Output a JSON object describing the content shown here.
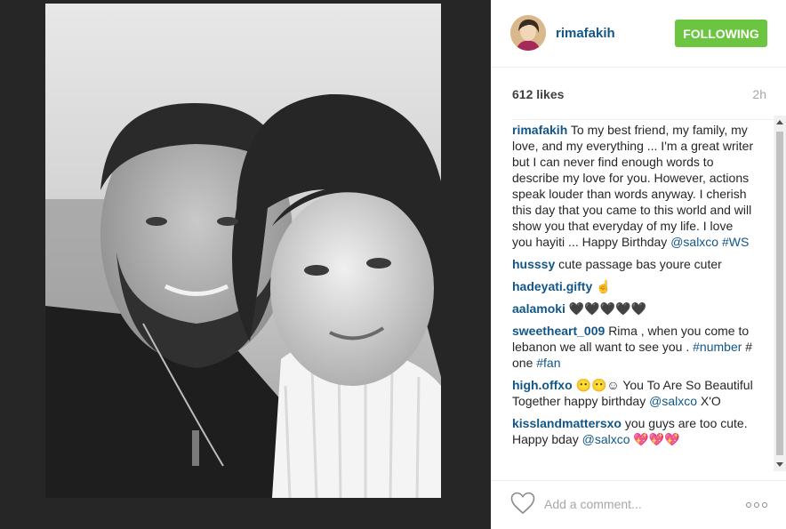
{
  "post": {
    "username": "rimafakih",
    "follow_label": "FOLLOWING",
    "likes": "612 likes",
    "time": "2h",
    "avatar_icon": "profile-photo",
    "comments": [
      {
        "user": "rimafakih",
        "text": "To my best friend, my family, my love, and my everything ... I'm a great writer but I can never find enough words to describe my love for you. However, actions speak louder than words anyway. I cherish this day that you came to this world and will show you that everyday of my life. I love you hayiti ... Happy Birthday ",
        "tag1": "@salxco",
        "mid": " ",
        "tag2": "#WS"
      },
      {
        "user": "husssy",
        "text": "cute passage bas youre cuter"
      },
      {
        "user": "hadeyati.gifty",
        "text": "☝"
      },
      {
        "user": "aalamoki",
        "text": "🖤🖤🖤🖤🖤"
      },
      {
        "user": "sweetheart_009",
        "text": "Rima , when you come to lebanon we all want to see you . ",
        "tag1": "#number",
        "mid": " # one ",
        "tag2": "#fan"
      },
      {
        "user": "high.offxo",
        "text": "😶😶☺ You To Are So Beautiful Together happy birthday ",
        "tag1": "@salxco",
        "mid": " X'O"
      },
      {
        "user": "kisslandmattersxo",
        "text": "you guys are too cute. Happy bday ",
        "tag1": "@salxco",
        "mid": " 💖💖💖"
      }
    ],
    "comment_placeholder": "Add a comment...",
    "heart_icon": "heart-icon",
    "more_icon": "more-options-icon"
  },
  "colors": {
    "follow_button": "#6bc541",
    "link": "#125688",
    "background": "#262626"
  }
}
